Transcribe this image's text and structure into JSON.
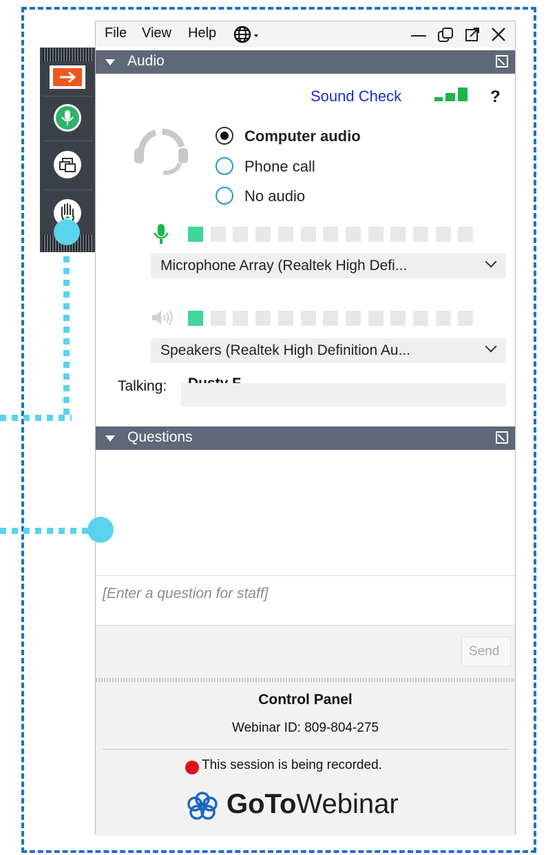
{
  "menu": {
    "file": "File",
    "view": "View",
    "help": "Help"
  },
  "audio": {
    "section_title": "Audio",
    "sound_check": "Sound Check",
    "help_glyph": "?",
    "options": [
      {
        "label": "Computer audio",
        "selected": true
      },
      {
        "label": "Phone call",
        "selected": false
      },
      {
        "label": "No audio",
        "selected": false
      }
    ],
    "mic_level": 1,
    "speaker_level": 1,
    "meter_segments": 13,
    "microphone": "Microphone Array (Realtek High Defi...",
    "speakers": "Speakers (Realtek High Definition Au...",
    "talking_label": "Talking:",
    "talking_name": "Dusty F..."
  },
  "questions": {
    "section_title": "Questions",
    "input_placeholder": "[Enter a question for staff]",
    "send": "Send"
  },
  "footer": {
    "control_panel": "Control Panel",
    "webinar_id": "Webinar ID: 809-804-275",
    "recording": "This session is being recorded.",
    "logo_goto": "GoTo",
    "logo_webinar": "Webinar"
  },
  "colors": {
    "section_bar": "#5f6778",
    "accent_orange": "#f2571d",
    "accent_green": "#2eb36b",
    "meter_on": "#3ed69a",
    "link_blue": "#1f2bd1",
    "annotation_blue": "#1a73c8",
    "annotation_cyan": "#5ad3ec",
    "record_red": "#e0101a"
  }
}
